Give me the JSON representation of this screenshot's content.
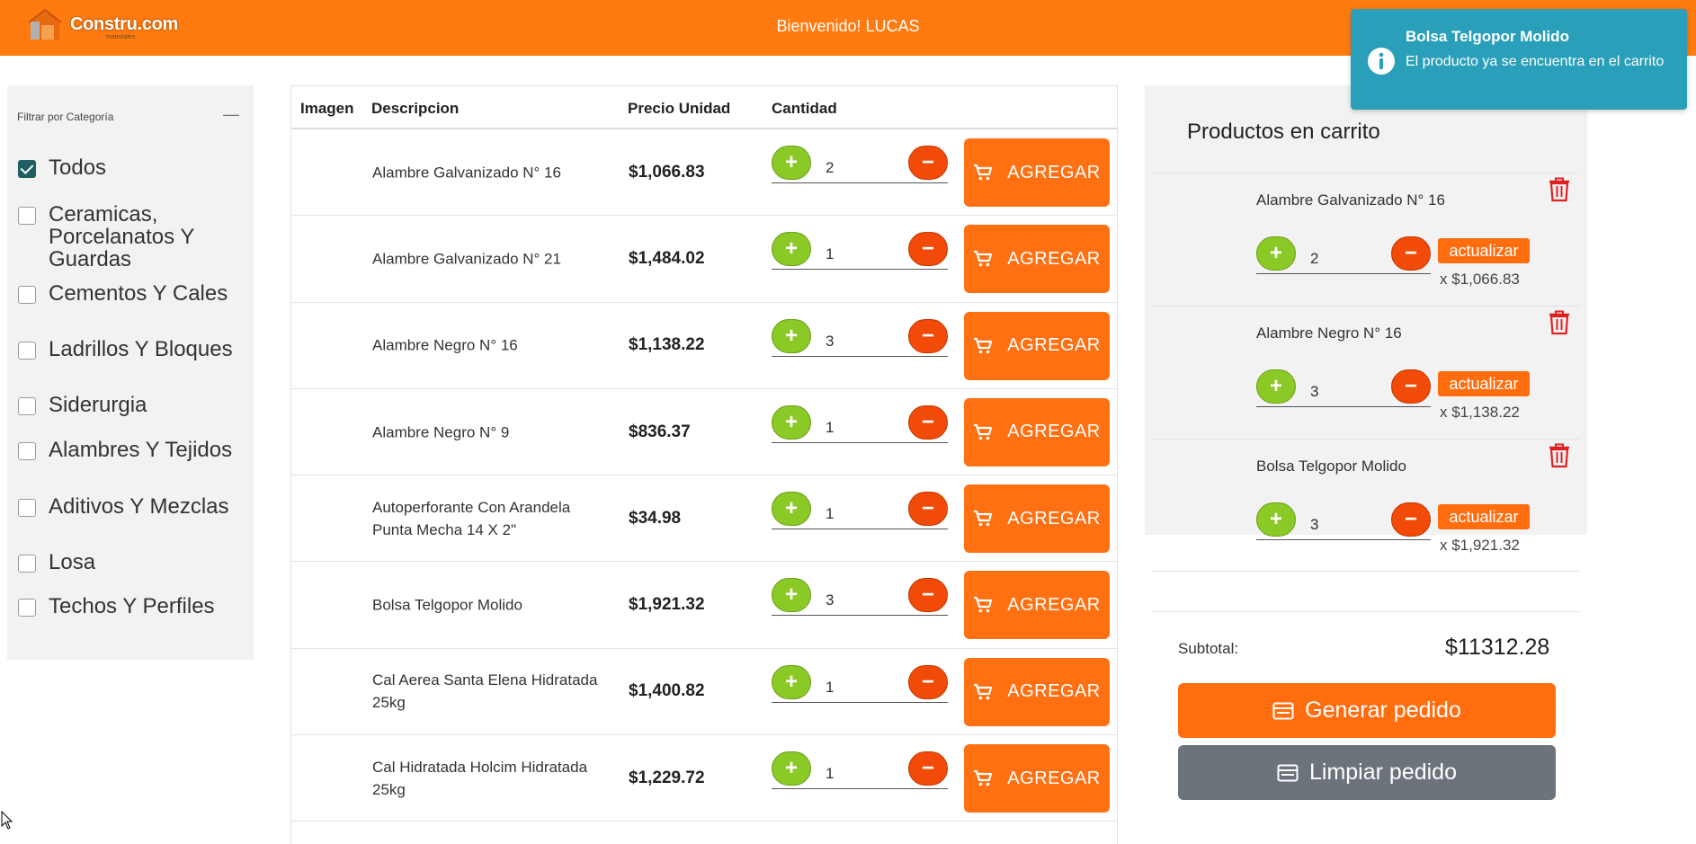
{
  "header": {
    "logo_text": "Constru.com",
    "logo_sub": "materiales",
    "welcome": "Bienvenido! LUCAS",
    "bg_color": "#ff7a0f"
  },
  "sidebar": {
    "filter_title": "Filtrar por Categoría",
    "collapse_symbol": "—",
    "categories": [
      {
        "label": "Todos",
        "checked": true
      },
      {
        "label": "Ceramicas, Porcelanatos Y Guardas",
        "checked": false
      },
      {
        "label": "Cementos Y Cales",
        "checked": false
      },
      {
        "label": "Ladrillos Y Bloques",
        "checked": false
      },
      {
        "label": "Siderurgia",
        "checked": false
      },
      {
        "label": "Alambres Y Tejidos",
        "checked": false
      },
      {
        "label": "Aditivos Y Mezclas",
        "checked": false
      },
      {
        "label": "Losa",
        "checked": false
      },
      {
        "label": "Techos Y Perfiles",
        "checked": false
      }
    ]
  },
  "table": {
    "headers": {
      "image": "Imagen",
      "description": "Descripcion",
      "unit_price": "Precio Unidad",
      "quantity": "Cantidad"
    },
    "add_label": "AGREGAR",
    "rows": [
      {
        "description": "Alambre Galvanizado N° 16",
        "price": "$1,066.83",
        "qty": "2"
      },
      {
        "description": "Alambre Galvanizado N° 21",
        "price": "$1,484.02",
        "qty": "1"
      },
      {
        "description": "Alambre Negro N° 16",
        "price": "$1,138.22",
        "qty": "3"
      },
      {
        "description": "Alambre Negro N° 9",
        "price": "$836.37",
        "qty": "1"
      },
      {
        "description": "Autoperforante Con Arandela Punta Mecha 14 X 2\"",
        "price": "$34.98",
        "qty": "1"
      },
      {
        "description": "Bolsa Telgopor Molido",
        "price": "$1,921.32",
        "qty": "3"
      },
      {
        "description": "Cal Aerea Santa Elena Hidratada 25kg",
        "price": "$1,400.82",
        "qty": "1"
      },
      {
        "description": "Cal Hidratada Holcim Hidratada 25kg",
        "price": "$1,229.72",
        "qty": "1"
      }
    ]
  },
  "cart": {
    "title": "Productos en carrito",
    "update_label": "actualizar",
    "items": [
      {
        "name": "Alambre Galvanizado N° 16",
        "qty": "2",
        "each": "x $1,066.83"
      },
      {
        "name": "Alambre Negro N° 16",
        "qty": "3",
        "each": "x $1,138.22"
      },
      {
        "name": "Bolsa Telgopor Molido",
        "qty": "3",
        "each": "x $1,921.32"
      }
    ],
    "subtotal_label": "Subtotal:",
    "subtotal_value": "$11312.28",
    "generate_label": "Generar pedido",
    "clear_label": "Limpiar pedido"
  },
  "toast": {
    "title": "Bolsa Telgopor Molido",
    "message": "El producto ya se encuentra en el carrito",
    "color": "#2a9fb9",
    "icon": "info-icon"
  },
  "colors": {
    "accent": "#ff7012",
    "plus": "#8bc926",
    "minus": "#f24a08",
    "trash": "#e02020",
    "toast": "#2a9fb9"
  }
}
